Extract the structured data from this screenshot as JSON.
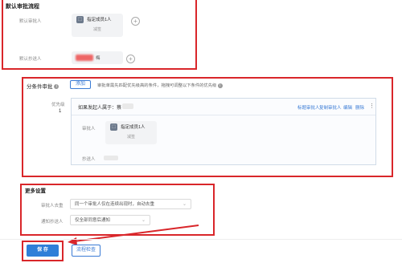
{
  "default_flow": {
    "title": "默认审批流程",
    "approver_label": "默认审批人",
    "approver_chip_name": "指定成员1人",
    "approver_chip_sub": "减签",
    "cc_label": "默认抄送人",
    "cc_blur_text": "梅"
  },
  "conditional": {
    "title": "分条件审批",
    "add_button": "添加",
    "hint": "审批单需先匹配优先级高的条件，拖拽可调整以下条件的优先级",
    "priority_label": "优先级",
    "priority_value": "1",
    "condition_text": "如果发起人属于：蔡",
    "actions": [
      "标题审批人",
      "复制审批人",
      "编辑",
      "删除"
    ],
    "more_icon": "⋮",
    "approver_label": "审批人",
    "approver_chip_name": "指定成员1人",
    "approver_chip_sub": "减签",
    "cc_label": "抄送人"
  },
  "more_settings": {
    "title": "更多设置",
    "dedupe_label": "审批人去重",
    "dedupe_value": "同一个审批人仅在连续出现时，自动去重",
    "notify_label": "通知抄送人",
    "notify_value": "仅全部同意后通知"
  },
  "footer": {
    "save_label": "保 存",
    "check_label": "流程检查"
  },
  "colors": {
    "annotation_red": "#d9262a",
    "primary_blue": "#3a7bd5"
  },
  "icons": {
    "user_icon": "user-icon",
    "add_icon": "plus-circle-icon",
    "info_icon": "info-icon"
  }
}
